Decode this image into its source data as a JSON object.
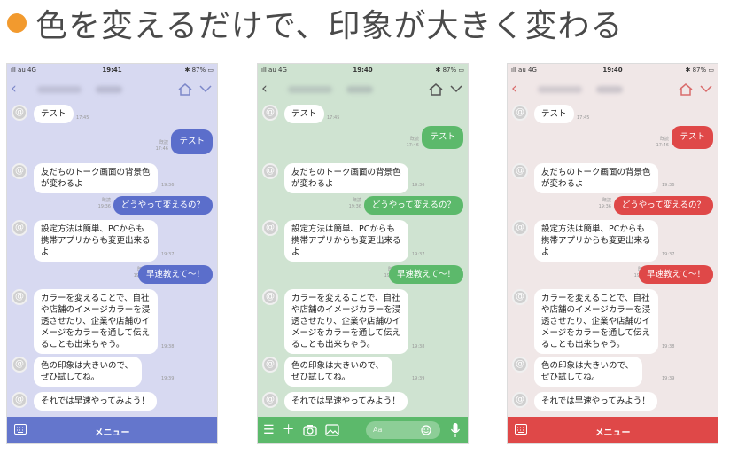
{
  "headline": {
    "text": "色を変えるだけで、印象が大きく変わる",
    "bullet_color": "#f29a2e"
  },
  "phones": [
    {
      "theme": {
        "bg": "#d7d9f1",
        "accent": "#5b6ecb",
        "bar": "#6476cc",
        "nav_icon": "#7d88c9"
      },
      "status": {
        "carrier": "ıll au 4G",
        "time": "19:41",
        "battery": "✱ 87% ▭"
      },
      "menu_label": "メニュー"
    },
    {
      "theme": {
        "bg": "#cfe3d1",
        "accent": "#5cb96b",
        "bar": "#5cb96b",
        "nav_icon": "#555555"
      },
      "status": {
        "carrier": "ıll au 4G",
        "time": "19:40",
        "battery": "✱ 87% ▭"
      },
      "input_placeholder": "Aa"
    },
    {
      "theme": {
        "bg": "#f0e7e7",
        "accent": "#df4848",
        "bar": "#df4848",
        "nav_icon": "#d96b6b"
      },
      "status": {
        "carrier": "ıll au 4G",
        "time": "19:40",
        "battery": "✱ 87% ▭"
      },
      "menu_label": "メニュー"
    }
  ],
  "chat": {
    "m1": {
      "text": "テスト",
      "time": "17:45"
    },
    "m2": {
      "text": "テスト",
      "meta": "既読\n17:46"
    },
    "m3": {
      "text": "友だちのトーク画面の背景色が変わるよ",
      "time": "19:36"
    },
    "m4": {
      "text": "どうやって変えるの？",
      "meta": "既読\n19:36"
    },
    "m5": {
      "text": "設定方法は簡単、PCからも携帯アプリからも変更出来るよ",
      "time": "19:37"
    },
    "m6": {
      "text": "早速教えて〜！",
      "meta": "既読\n19:38"
    },
    "m7": {
      "text": "カラーを変えることで、自社や店舗のイメージカラーを浸透させたり、企業や店舗のイメージをカラーを通して伝えることも出来ちゃう。",
      "time": "19:38"
    },
    "m8": {
      "text": "色の印象は大きいので、ぜひ試してね。",
      "time": "19:39"
    },
    "m9": {
      "text": "それでは早速やってみよう！"
    }
  }
}
